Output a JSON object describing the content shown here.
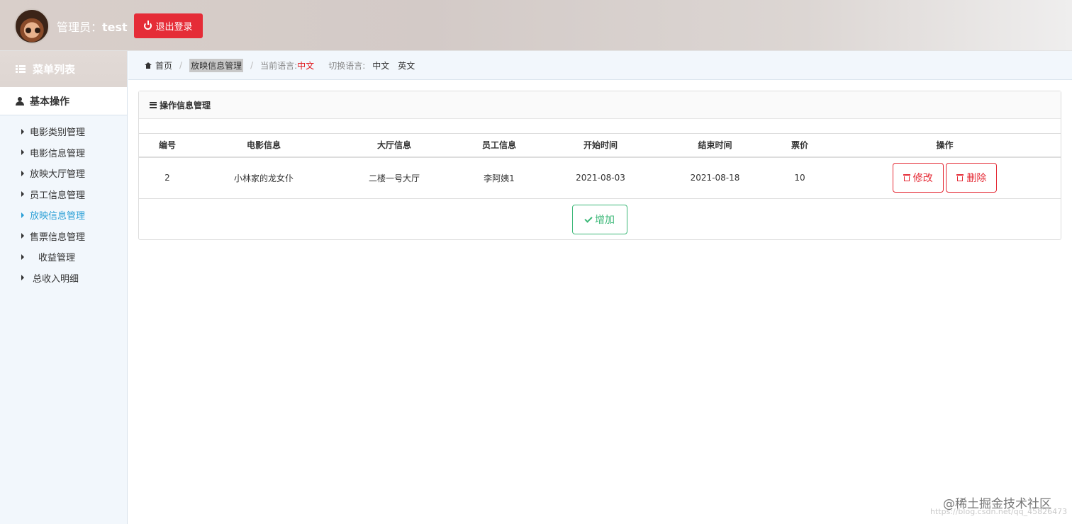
{
  "header": {
    "admin_prefix": "管理员：",
    "admin_name": "test",
    "logout_label": "退出登录"
  },
  "sidebar": {
    "menu_title": "菜单列表",
    "section_title": "基本操作",
    "items": [
      {
        "label": "电影类别管理"
      },
      {
        "label": "电影信息管理"
      },
      {
        "label": "放映大厅管理"
      },
      {
        "label": "员工信息管理"
      },
      {
        "label": "放映信息管理",
        "active": true
      },
      {
        "label": "售票信息管理"
      },
      {
        "label": "收益管理"
      },
      {
        "label": "总收入明细"
      }
    ]
  },
  "breadcrumb": {
    "home": "首页",
    "current": "放映信息管理",
    "current_lang_label": "当前语言:",
    "current_lang": "中文",
    "switch_lang_label": "切换语言:",
    "lang_zh": "中文",
    "lang_en": "英文"
  },
  "panel": {
    "title": "操作信息管理",
    "columns": [
      "编号",
      "电影信息",
      "大厅信息",
      "员工信息",
      "开始时间",
      "结束时间",
      "票价",
      "操作"
    ],
    "rows": [
      {
        "id": "2",
        "movie": "小林家的龙女仆",
        "hall": "二楼一号大厅",
        "staff": "李阿姨1",
        "start": "2021-08-03",
        "end": "2021-08-18",
        "price": "10"
      }
    ],
    "edit_label": "修改",
    "delete_label": "删除",
    "add_label": "增加"
  },
  "watermark": {
    "main": "@稀土掘金技术社区",
    "sub": "https://blog.csdn.net/qq_45826473"
  },
  "colors": {
    "danger": "#e52c37",
    "success": "#3cb878",
    "active_link": "#2a9fd6"
  }
}
